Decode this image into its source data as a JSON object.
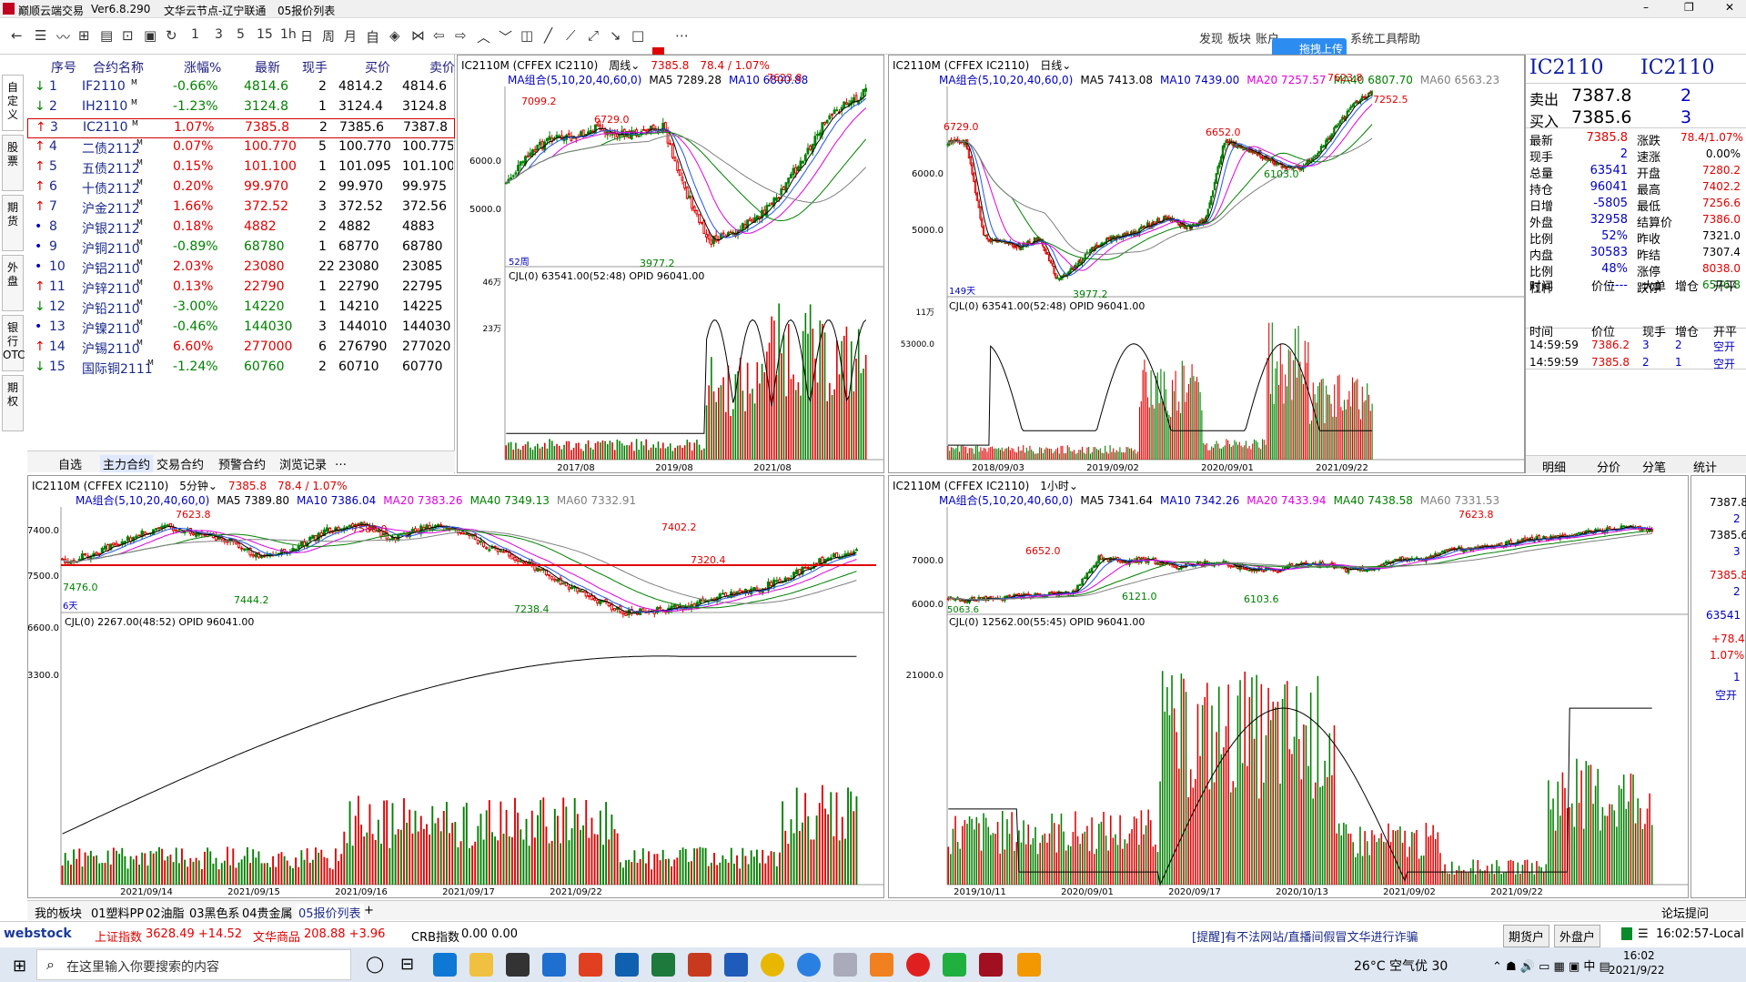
{
  "app": {
    "title": "巅顺云端交易",
    "version": "Ver6.8.290",
    "server": "文华云节点-辽宁联通",
    "page_name": "05报价列表"
  },
  "toolbar": {
    "periods": [
      "1",
      "3",
      "5",
      "15",
      "1h",
      "日",
      "周",
      "月"
    ],
    "right_menu": [
      "发现",
      "板块",
      "账户",
      "拖拽上传",
      "系统工具",
      "帮助"
    ]
  },
  "left_tabs": [
    "自定义",
    "股票",
    "期货",
    "外盘",
    "银行OTC",
    "期权"
  ],
  "quote": {
    "headers": [
      "序号",
      "合约名称",
      "涨幅%",
      "最新",
      "现手",
      "买价",
      "卖价"
    ],
    "rows": [
      {
        "no": "1",
        "name": "IF2110",
        "change": "-0.66%",
        "last": "4814.6",
        "vol": "2",
        "bid": "4814.2",
        "ask": "4814.6",
        "dir": "down"
      },
      {
        "no": "2",
        "name": "IH2110",
        "change": "-1.23%",
        "last": "3124.8",
        "vol": "1",
        "bid": "3124.4",
        "ask": "3124.8",
        "dir": "down"
      },
      {
        "no": "3",
        "name": "IC2110",
        "change": "1.07%",
        "last": "7385.8",
        "vol": "2",
        "bid": "7385.6",
        "ask": "7387.8",
        "dir": "up"
      },
      {
        "no": "4",
        "name": "二债2112",
        "change": "0.07%",
        "last": "100.770",
        "vol": "5",
        "bid": "100.770",
        "ask": "100.775",
        "dir": "up"
      },
      {
        "no": "5",
        "name": "五债2112",
        "change": "0.15%",
        "last": "101.100",
        "vol": "1",
        "bid": "101.095",
        "ask": "101.100",
        "dir": "up"
      },
      {
        "no": "6",
        "name": "十债2112",
        "change": "0.20%",
        "last": "99.970",
        "vol": "2",
        "bid": "99.970",
        "ask": "99.975",
        "dir": "up"
      },
      {
        "no": "7",
        "name": "沪金2112",
        "change": "1.66%",
        "last": "372.52",
        "vol": "3",
        "bid": "372.52",
        "ask": "372.56",
        "dir": "up"
      },
      {
        "no": "8",
        "name": "沪银2112",
        "change": "0.18%",
        "last": "4882",
        "vol": "2",
        "bid": "4882",
        "ask": "4883",
        "dir": "dot"
      },
      {
        "no": "9",
        "name": "沪铜2110",
        "change": "-0.89%",
        "last": "68780",
        "vol": "1",
        "bid": "68770",
        "ask": "68780",
        "dir": "dot"
      },
      {
        "no": "10",
        "name": "沪铝2110",
        "change": "2.03%",
        "last": "23080",
        "vol": "22",
        "bid": "23080",
        "ask": "23085",
        "dir": "dot"
      },
      {
        "no": "11",
        "name": "沪锌2110",
        "change": "0.13%",
        "last": "22790",
        "vol": "1",
        "bid": "22790",
        "ask": "22795",
        "dir": "up"
      },
      {
        "no": "12",
        "name": "沪铅2110",
        "change": "-3.00%",
        "last": "14220",
        "vol": "1",
        "bid": "14210",
        "ask": "14225",
        "dir": "down"
      },
      {
        "no": "13",
        "name": "沪镍2110",
        "change": "-0.46%",
        "last": "144030",
        "vol": "3",
        "bid": "144010",
        "ask": "144030",
        "dir": "dot"
      },
      {
        "no": "14",
        "name": "沪锡2110",
        "change": "6.60%",
        "last": "277000",
        "vol": "6",
        "bid": "276790",
        "ask": "277020",
        "dir": "up"
      },
      {
        "no": "15",
        "name": "国际铜2111",
        "change": "-1.24%",
        "last": "60760",
        "vol": "2",
        "bid": "60710",
        "ask": "60770",
        "dir": "down"
      }
    ],
    "tabs": [
      "自选",
      "主力合约",
      "交易合约",
      "预警合约",
      "浏览记录",
      "…"
    ]
  },
  "charts": {
    "weekly": {
      "head": "IC2110M (CFFEX IC2110)",
      "period": "周线",
      "price": "7385.8",
      "chg": "78.4 / 1.07%",
      "ma": [
        "MA组合(5,10,20,40,60,0)",
        "MA5 7289.28",
        "MA10 6800.88"
      ],
      "labels": [
        "7623.8",
        "7099.2",
        "6729.0",
        "3977.2",
        "6000.0",
        "5000.0",
        "52周"
      ],
      "vol": [
        "CJL(0)",
        "63541.00(52:48)",
        "OPID 96041.00"
      ],
      "vol_ticks": [
        "46万",
        "23万"
      ],
      "dates": [
        "2017/08",
        "2019/08",
        "2021/08"
      ]
    },
    "daily": {
      "head": "IC2110M (CFFEX IC2110)",
      "period": "日线",
      "ma": [
        "MA组合(5,10,20,40,60,0)",
        "MA5 7413.08",
        "MA10 7439.00",
        "MA20 7257.57",
        "MA40 6807.70",
        "MA60 6563.23"
      ],
      "labels": [
        "7623.8",
        "7252.5",
        "6729.0",
        "6652.0",
        "6103.0",
        "3977.2",
        "6000.0",
        "5000.0",
        "149天"
      ],
      "vol": [
        "CJL(0)",
        "63541.00(52:48)",
        "OPID 96041.00"
      ],
      "vol_ticks": [
        "11万",
        "53000.0"
      ],
      "dates": [
        "2018/09/03",
        "2019/09/02",
        "2020/09/01",
        "2021/09/22"
      ]
    },
    "min5": {
      "head": "IC2110M (CFFEX IC2110)",
      "period": "5分钟",
      "price": "7385.8",
      "chg": "78.4 / 1.07%",
      "ma": [
        "MA组合(5,10,20,40,60,0)",
        "MA5 7389.80",
        "MA10 7386.04",
        "MA20 7383.26",
        "MA40 7349.13",
        "MA60 7332.91"
      ],
      "labels": [
        "7623.8",
        "7588.0",
        "7476.0",
        "7444.2",
        "7402.2",
        "7320.4",
        "7238.4",
        "7500.0",
        "7400.0",
        "6天"
      ],
      "vol": [
        "CJL(0)",
        "2267.00(48:52)",
        "OPID 96041.00"
      ],
      "vol_ticks": [
        "6600.0",
        "3300.0"
      ],
      "dates": [
        "2021/09/14",
        "2021/09/15",
        "2021/09/16",
        "2021/09/17",
        "2021/09/22"
      ]
    },
    "hour1": {
      "head": "IC2110M (CFFEX IC2110)",
      "period": "1小时",
      "ma": [
        "MA组合(5,10,20,40,60,0)",
        "MA5 7341.64",
        "MA10 7342.26",
        "MA20 7433.94",
        "MA40 7438.58",
        "MA60 7331.53"
      ],
      "labels": [
        "7623.8",
        "6652.0",
        "6121.0",
        "6103.6",
        "5063.6",
        "7000.0",
        "6000.0"
      ],
      "vol": [
        "CJL(0)",
        "12562.00(55:45)",
        "OPID 96041.00"
      ],
      "vol_ticks": [
        "21000.0"
      ],
      "dates": [
        "2019/10/11",
        "2020/09/01",
        "2020/09/17",
        "2020/10/13",
        "2021/09/02",
        "2021/09/22"
      ]
    }
  },
  "info": {
    "symbol": "IC2110",
    "symbol2": "IC2110",
    "sell": {
      "label": "卖出",
      "price": "7387.8",
      "vol": "2"
    },
    "buy": {
      "label": "买入",
      "price": "7385.6",
      "vol": "3"
    },
    "left": [
      [
        "最新",
        "7385.8"
      ],
      [
        "现手",
        "2"
      ],
      [
        "总量",
        "63541"
      ],
      [
        "持仓",
        "96041"
      ],
      [
        "日增",
        "-5805"
      ],
      [
        "外盘",
        "32958"
      ],
      [
        "比例",
        "52%"
      ],
      [
        "内盘",
        "30583"
      ],
      [
        "比例",
        "48%"
      ],
      [
        "杠杆",
        "-----"
      ]
    ],
    "right": [
      [
        "涨跌",
        "78.4/1.07%"
      ],
      [
        "速涨",
        "0.00%"
      ],
      [
        "开盘",
        "7280.2"
      ],
      [
        "最高",
        "7402.2"
      ],
      [
        "最低",
        "7256.6"
      ],
      [
        "结算价",
        "7386.0"
      ],
      [
        "昨收",
        "7321.0"
      ],
      [
        "昨结",
        "7307.4"
      ],
      [
        "涨停",
        "8038.0"
      ],
      [
        "跌停",
        "6576.8"
      ]
    ],
    "tick_head1": [
      "时间",
      "价位",
      "大单",
      "增仓",
      "开平"
    ],
    "tick_head2": [
      "时间",
      "价位",
      "现手",
      "增仓",
      "开平"
    ],
    "ticks": [
      [
        "14:59:59",
        "7386.2",
        "3",
        "2",
        "空开"
      ],
      [
        "14:59:59",
        "7385.8",
        "2",
        "1",
        "空开"
      ]
    ],
    "tabs": [
      "明细",
      "分价",
      "分笔",
      "统计"
    ]
  },
  "side_scale": [
    "7387.8",
    "2",
    "7385.6",
    "3",
    "7385.8",
    "2",
    "63541",
    "+78.4",
    "1.07%",
    "1",
    "空开"
  ],
  "bottom_tabs": [
    "我的板块",
    "01塑料PP",
    "02油脂",
    "03黑色系",
    "04贵金属",
    "05报价列表",
    "+"
  ],
  "forum": "论坛提问",
  "status": {
    "brand": "webstock",
    "sh": "上证指数",
    "sh_val": "3628.49 +14.52",
    "wh": "文华商品",
    "wh_val": "208.88 +3.96",
    "crb": "CRB指数",
    "crb_val": "0.00 0.00",
    "notice": "[提醒]有不法网站/直播间假冒文华进行诈骗",
    "btn1": "期货户",
    "btn2": "外盘户",
    "time": "16:02:57-Local"
  },
  "taskbar": {
    "search": "在这里输入你要搜索的内容",
    "weather": "26°C 空气优 30",
    "clock": "16:02",
    "date": "2021/9/22"
  },
  "colors": {
    "up": "#e00000",
    "down": "#008000",
    "ma5": "#000000",
    "ma10": "#2255ee",
    "ma20": "#e000e0",
    "ma40": "#008000",
    "ma60": "#808080",
    "hline": "#e00000"
  }
}
